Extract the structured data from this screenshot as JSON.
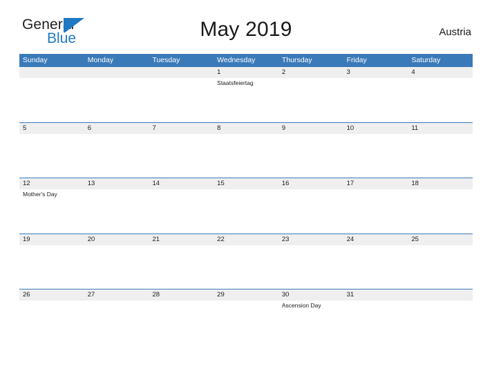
{
  "brand": {
    "name_part1": "General",
    "name_part2": "Blue",
    "accent_color": "#1f78c1"
  },
  "header": {
    "title": "May 2019",
    "country": "Austria"
  },
  "colors": {
    "header_blue": "#3a7ab9",
    "date_band_gray": "#efefef",
    "text": "#1a1a1a"
  },
  "calendar": {
    "weekdays": [
      "Sunday",
      "Monday",
      "Tuesday",
      "Wednesday",
      "Thursday",
      "Friday",
      "Saturday"
    ],
    "weeks": [
      {
        "dates": [
          "",
          "",
          "",
          "1",
          "2",
          "3",
          "4"
        ],
        "events": [
          "",
          "",
          "",
          "Staatsfeiertag",
          "",
          "",
          ""
        ]
      },
      {
        "dates": [
          "5",
          "6",
          "7",
          "8",
          "9",
          "10",
          "11"
        ],
        "events": [
          "",
          "",
          "",
          "",
          "",
          "",
          ""
        ]
      },
      {
        "dates": [
          "12",
          "13",
          "14",
          "15",
          "16",
          "17",
          "18"
        ],
        "events": [
          "Mother's Day",
          "",
          "",
          "",
          "",
          "",
          ""
        ]
      },
      {
        "dates": [
          "19",
          "20",
          "21",
          "22",
          "23",
          "24",
          "25"
        ],
        "events": [
          "",
          "",
          "",
          "",
          "",
          "",
          ""
        ]
      },
      {
        "dates": [
          "26",
          "27",
          "28",
          "29",
          "30",
          "31",
          ""
        ],
        "events": [
          "",
          "",
          "",
          "",
          "Ascension Day",
          "",
          ""
        ]
      }
    ]
  }
}
